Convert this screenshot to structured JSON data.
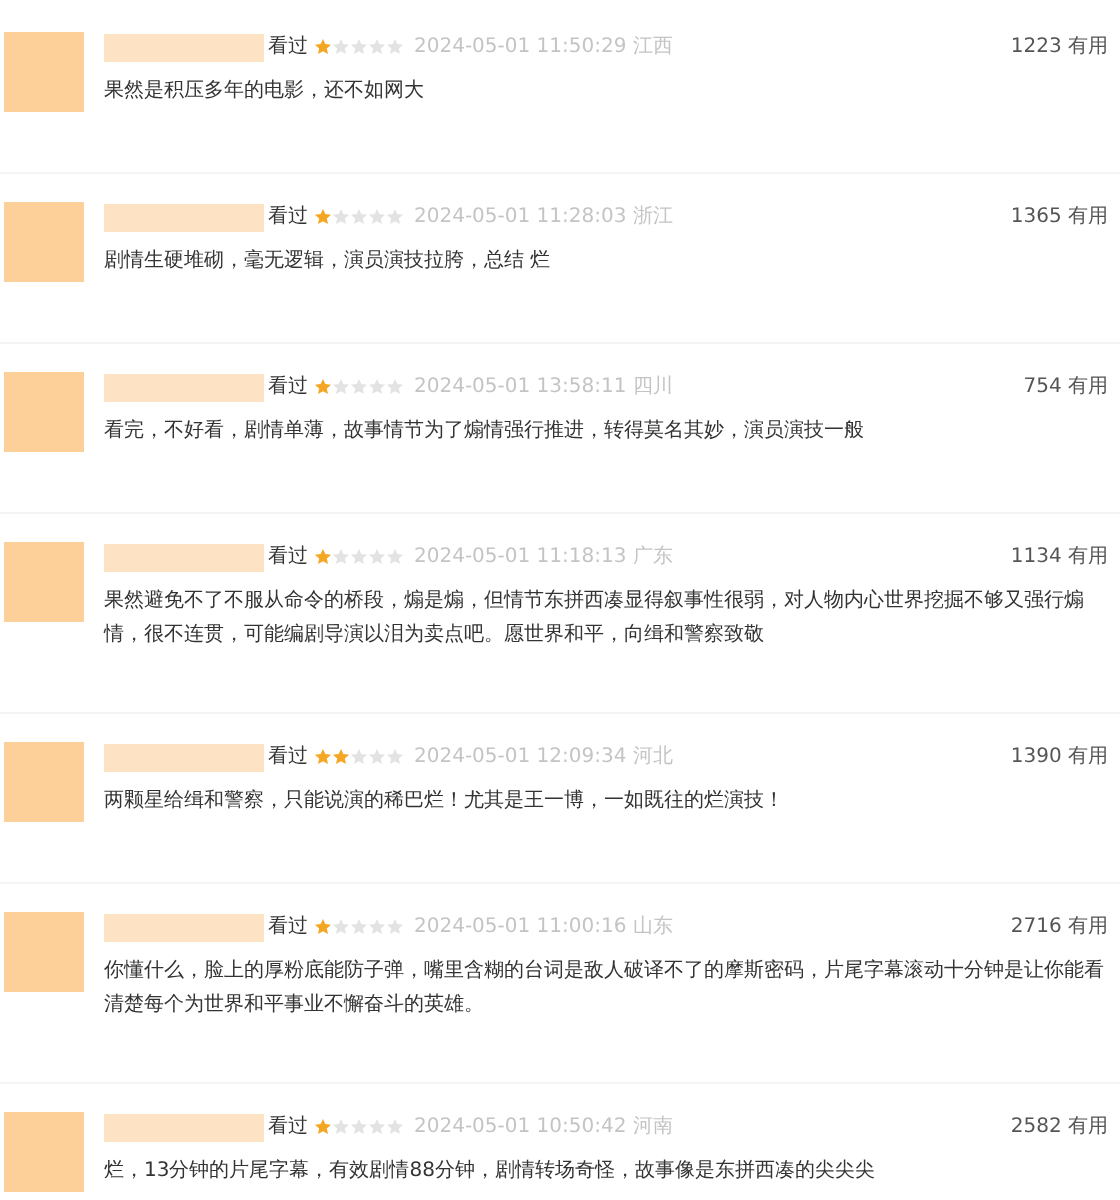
{
  "reviews": [
    {
      "status": "看过",
      "stars": 1,
      "time": "2024-05-01 11:50:29 江西",
      "votes": "1223 有用",
      "text": "果然是积压多年的电影，还不如网大"
    },
    {
      "status": "看过",
      "stars": 1,
      "time": "2024-05-01 11:28:03 浙江",
      "votes": "1365 有用",
      "text": "剧情生硬堆砌，毫无逻辑，演员演技拉胯，总结 烂"
    },
    {
      "status": "看过",
      "stars": 1,
      "time": "2024-05-01 13:58:11 四川",
      "votes": "754 有用",
      "text": "看完，不好看，剧情单薄，故事情节为了煽情强行推进，转得莫名其妙，演员演技一般"
    },
    {
      "status": "看过",
      "stars": 1,
      "time": "2024-05-01 11:18:13 广东",
      "votes": "1134 有用",
      "text": "果然避免不了不服从命令的桥段，煽是煽，但情节东拼西凑显得叙事性很弱，对人物内心世界挖掘不够又强行煽情，很不连贯，可能编剧导演以泪为卖点吧。愿世界和平，向缉和警察致敬"
    },
    {
      "status": "看过",
      "stars": 2,
      "time": "2024-05-01 12:09:34 河北",
      "votes": "1390 有用",
      "text": "两颗星给缉和警察，只能说演的稀巴烂！尤其是王一博，一如既往的烂演技！"
    },
    {
      "status": "看过",
      "stars": 1,
      "time": "2024-05-01 11:00:16 山东",
      "votes": "2716 有用",
      "text": "你懂什么，脸上的厚粉底能防子弹，嘴里含糊的台词是敌人破译不了的摩斯密码，片尾字幕滚动十分钟是让你能看清楚每个为世界和平事业不懈奋斗的英雄。"
    },
    {
      "status": "看过",
      "stars": 1,
      "time": "2024-05-01 10:50:42 河南",
      "votes": "2582 有用",
      "text": "烂，13分钟的片尾字幕，有效剧情88分钟，剧情转场奇怪，故事像是东拼西凑的尖尖尖"
    }
  ]
}
